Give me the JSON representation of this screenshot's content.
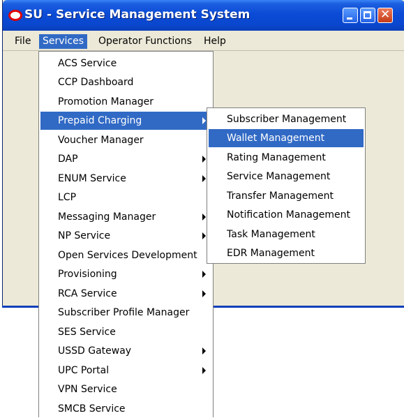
{
  "window": {
    "title": "SU - Service Management System"
  },
  "menubar": {
    "items": [
      "File",
      "Services",
      "Operator Functions",
      "Help"
    ]
  },
  "services_menu": {
    "items": [
      {
        "label": "ACS Service"
      },
      {
        "label": "CCP Dashboard"
      },
      {
        "label": "Promotion Manager"
      },
      {
        "label": "Prepaid Charging"
      },
      {
        "label": "Voucher Manager"
      },
      {
        "label": "DAP"
      },
      {
        "label": "ENUM Service"
      },
      {
        "label": "LCP"
      },
      {
        "label": "Messaging Manager"
      },
      {
        "label": "NP Service"
      },
      {
        "label": "Open Services Development"
      },
      {
        "label": "Provisioning"
      },
      {
        "label": "RCA Service"
      },
      {
        "label": "Subscriber Profile Manager"
      },
      {
        "label": "SES Service"
      },
      {
        "label": "USSD Gateway"
      },
      {
        "label": "UPC Portal"
      },
      {
        "label": "VPN Service"
      },
      {
        "label": "SMCB Service"
      }
    ]
  },
  "prepaid_submenu": {
    "items": [
      {
        "label": "Subscriber Management"
      },
      {
        "label": "Wallet Management"
      },
      {
        "label": "Rating Management"
      },
      {
        "label": "Service Management"
      },
      {
        "label": "Transfer Management"
      },
      {
        "label": "Notification Management"
      },
      {
        "label": "Task Management"
      },
      {
        "label": "EDR Management"
      }
    ]
  },
  "icons": {
    "app_logo": "oracle-logo-icon",
    "submenu_indicator": "arrow-right-icon"
  },
  "colors": {
    "titlebar": "#0b4bd6",
    "selection": "#316ac5",
    "window_bg": "#ece9d8",
    "logo": "#e00000"
  }
}
